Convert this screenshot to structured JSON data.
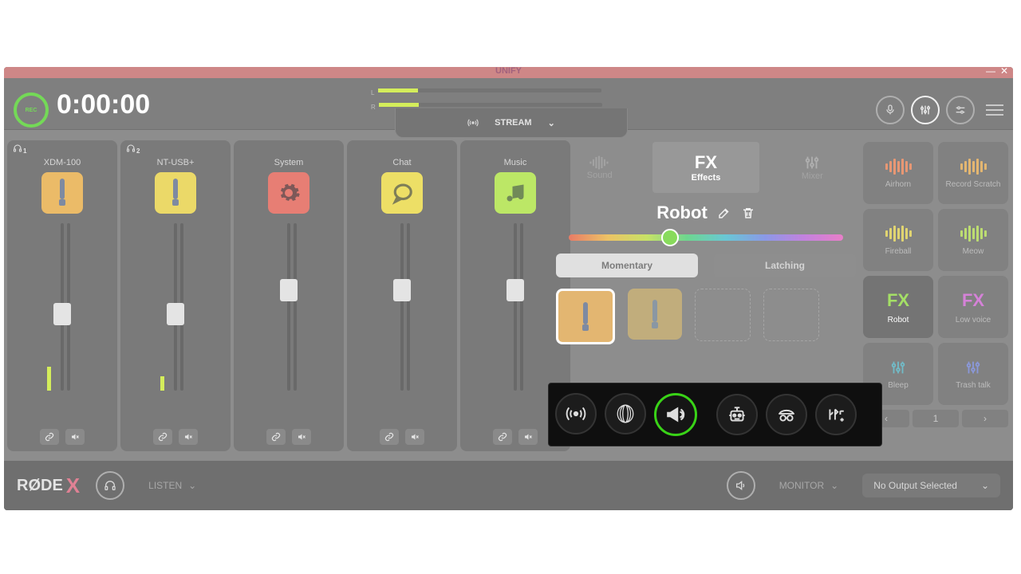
{
  "title": "UNIFY",
  "timer": "0:00:00",
  "streamLabel": "STREAM",
  "meterLabels": {
    "l": "L",
    "r": "R"
  },
  "topButtons": {
    "rec": "REC"
  },
  "channels": [
    {
      "name": "XDM-100",
      "iconColor": "#e6a83e",
      "kind": "mic",
      "hp": "1",
      "knobTop": 100,
      "level": 30
    },
    {
      "name": "NT-USB+",
      "iconColor": "#e6cf3e",
      "kind": "mic",
      "hp": "2",
      "knobTop": 100,
      "level": 18
    },
    {
      "name": "System",
      "iconColor": "#e05a4d",
      "kind": "gear",
      "knobTop": 70,
      "level": 0
    },
    {
      "name": "Chat",
      "iconColor": "#e8d63c",
      "kind": "chat",
      "knobTop": 70,
      "level": 0
    },
    {
      "name": "Music",
      "iconColor": "#a9e03c",
      "kind": "music",
      "knobTop": 70,
      "level": 0
    }
  ],
  "fxTabs": [
    {
      "big": "",
      "lab": "Sound"
    },
    {
      "big": "FX",
      "lab": "Effects"
    },
    {
      "big": "",
      "lab": "Mixer"
    }
  ],
  "fxTitle": "Robot",
  "mode": {
    "momentary": "Momentary",
    "latching": "Latching"
  },
  "effectCards": [
    {
      "label": "Airhorn",
      "color": "#e07a4d"
    },
    {
      "label": "Record Scratch",
      "color": "#dca24a"
    },
    {
      "label": "Fireball",
      "color": "#d8c84a"
    },
    {
      "label": "Meow",
      "color": "#a9d24a"
    },
    {
      "label": "Robot",
      "fx": true,
      "color": "#8bd63c",
      "sel": true
    },
    {
      "label": "Low voice",
      "fx": true,
      "color": "#c95fce"
    },
    {
      "label": "Bleep",
      "sliders": true,
      "color": "#4aa8b8"
    },
    {
      "label": "Trash talk",
      "sliders": true,
      "color": "#6a7bcf"
    }
  ],
  "effectPage": "1",
  "fxButtons": [
    {
      "name": "echo"
    },
    {
      "name": "reverb"
    },
    {
      "name": "megaphone",
      "sel": true
    },
    {
      "name": "robot"
    },
    {
      "name": "incognito"
    },
    {
      "name": "pitch"
    }
  ],
  "bottom": {
    "brand1": "RØDE",
    "brand2": "X",
    "listen": "LISTEN",
    "monitor": "MONITOR",
    "output": "No Output Selected"
  }
}
